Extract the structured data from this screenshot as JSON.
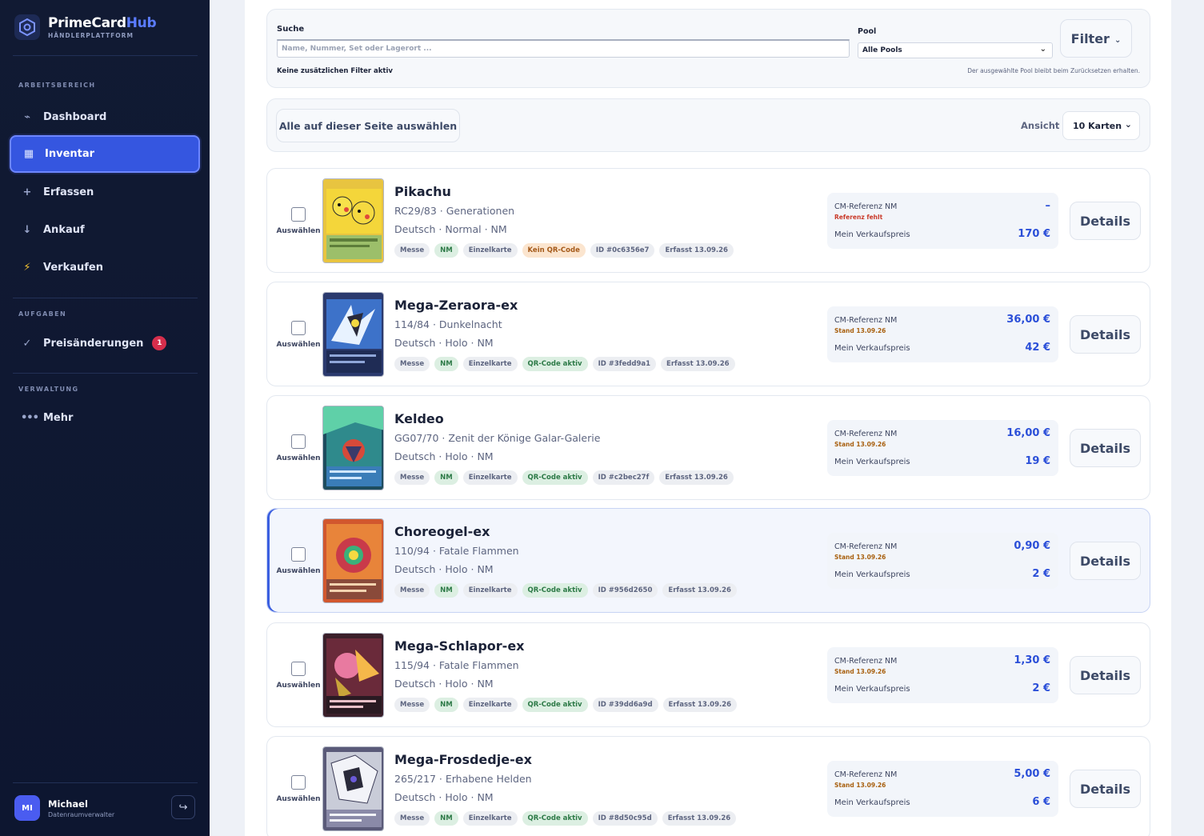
{
  "brand": {
    "name_main": "PrimeCard",
    "name_accent": "Hub",
    "subtitle": "HÄNDLERPLATTFORM"
  },
  "sidebar": {
    "sections": {
      "workspace": "ARBEITSBEREICH",
      "tasks": "AUFGABEN",
      "admin": "VERWALTUNG"
    },
    "items": [
      {
        "label": "Dashboard",
        "icon": "pulse-icon"
      },
      {
        "label": "Inventar",
        "icon": "grid-icon",
        "active": true
      },
      {
        "label": "Erfassen",
        "icon": "plus-icon"
      },
      {
        "label": "Ankauf",
        "icon": "arrow-down-icon"
      },
      {
        "label": "Verkaufen",
        "icon": "bolt-icon"
      },
      {
        "label": "Preisänderungen",
        "icon": "check-icon",
        "badge": "1"
      },
      {
        "label": "Mehr",
        "icon": "more-icon"
      }
    ],
    "user": {
      "initials": "MI",
      "name": "Michael",
      "role": "Datenraumverwalter"
    }
  },
  "search": {
    "label": "Suche",
    "placeholder": "Name, Nummer, Set oder Lagerort ...",
    "filter_hint": "Keine zusätzlichen Filter aktiv",
    "pool_label": "Pool",
    "pool_value": "Alle Pools",
    "pool_hint": "Der ausgewählte Pool bleibt beim Zurücksetzen erhalten.",
    "filter_button": "Filter"
  },
  "toolbar": {
    "select_all": "Alle auf dieser Seite auswählen",
    "view_label": "Ansicht",
    "view_value": "10 Karten"
  },
  "colors": {
    "accent": "#3556e0",
    "price": "#2b4fd8",
    "sidebar_bg": "#111a33"
  },
  "cards": [
    {
      "name": "Pikachu",
      "set": "RC29/83 · Generationen",
      "variant": "Deutsch · Normal · NM",
      "tags": [
        "Messe",
        "NM",
        "Einzelkarte",
        "Kein QR-Code",
        "ID #0c6356e7",
        "Erfasst 13.09.26"
      ],
      "ref_label": "CM-Referenz NM",
      "ref_status": "Referenz fehlt",
      "ref_value": "–",
      "sell_label": "Mein Verkaufspreis",
      "sell_value": "170 €",
      "select_label": "Auswählen",
      "details": "Details"
    },
    {
      "name": "Mega-Zeraora-ex",
      "set": "114/84 · Dunkelnacht",
      "variant": "Deutsch · Holo · NM",
      "tags": [
        "Messe",
        "NM",
        "Einzelkarte",
        "QR-Code aktiv",
        "ID #3fedd9a1",
        "Erfasst 13.09.26"
      ],
      "ref_label": "CM-Referenz NM",
      "ref_status": "Stand 13.09.26",
      "ref_value": "36,00 €",
      "sell_label": "Mein Verkaufspreis",
      "sell_value": "42 €",
      "select_label": "Auswählen",
      "details": "Details"
    },
    {
      "name": "Keldeo",
      "set": "GG07/70 · Zenit der Könige Galar-Galerie",
      "variant": "Deutsch · Holo · NM",
      "tags": [
        "Messe",
        "NM",
        "Einzelkarte",
        "QR-Code aktiv",
        "ID #c2bec27f",
        "Erfasst 13.09.26"
      ],
      "ref_label": "CM-Referenz NM",
      "ref_status": "Stand 13.09.26",
      "ref_value": "16,00 €",
      "sell_label": "Mein Verkaufspreis",
      "sell_value": "19 €",
      "select_label": "Auswählen",
      "details": "Details"
    },
    {
      "name": "Choreogel-ex",
      "set": "110/94 · Fatale Flammen",
      "variant": "Deutsch · Holo · NM",
      "tags": [
        "Messe",
        "NM",
        "Einzelkarte",
        "QR-Code aktiv",
        "ID #956d2650",
        "Erfasst 13.09.26"
      ],
      "ref_label": "CM-Referenz NM",
      "ref_status": "Stand 13.09.26",
      "ref_value": "0,90 €",
      "sell_label": "Mein Verkaufspreis",
      "sell_value": "2 €",
      "select_label": "Auswählen",
      "details": "Details"
    },
    {
      "name": "Mega-Schlapor-ex",
      "set": "115/94 · Fatale Flammen",
      "variant": "Deutsch · Holo · NM",
      "tags": [
        "Messe",
        "NM",
        "Einzelkarte",
        "QR-Code aktiv",
        "ID #39dd6a9d",
        "Erfasst 13.09.26"
      ],
      "ref_label": "CM-Referenz NM",
      "ref_status": "Stand 13.09.26",
      "ref_value": "1,30 €",
      "sell_label": "Mein Verkaufspreis",
      "sell_value": "2 €",
      "select_label": "Auswählen",
      "details": "Details"
    },
    {
      "name": "Mega-Frosdedje-ex",
      "set": "265/217 · Erhabene Helden",
      "variant": "Deutsch · Holo · NM",
      "tags": [
        "Messe",
        "NM",
        "Einzelkarte",
        "QR-Code aktiv",
        "ID #8d50c95d",
        "Erfasst 13.09.26"
      ],
      "ref_label": "CM-Referenz NM",
      "ref_status": "Stand 13.09.26",
      "ref_value": "5,00 €",
      "sell_label": "Mein Verkaufspreis",
      "sell_value": "6 €",
      "select_label": "Auswählen",
      "details": "Details"
    }
  ]
}
